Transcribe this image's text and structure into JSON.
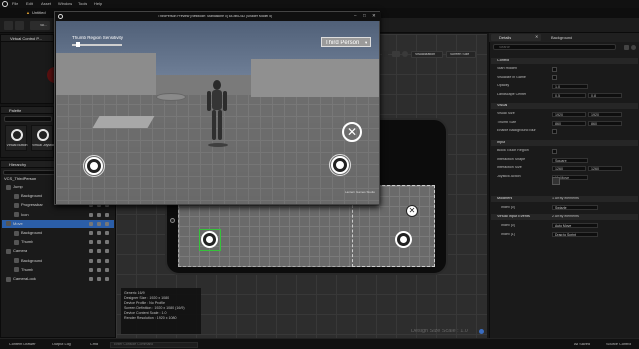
{
  "menu": {
    "items": [
      "File",
      "Edit",
      "Asset",
      "Window",
      "Tools",
      "Help"
    ],
    "project": "Untitled"
  },
  "doc_tab": "Sk...",
  "virtual_control_tab": "Virtual Control P...",
  "palette": {
    "title": "Palette",
    "items": [
      "Virtual Button",
      "Virtual Joystick"
    ]
  },
  "hierarchy": {
    "title": "Hierarchy",
    "root": "VCS_ThirdPerson",
    "rows": [
      {
        "label": "Jump",
        "indent": 1,
        "selected": false
      },
      {
        "label": "Background",
        "indent": 2,
        "selected": false
      },
      {
        "label": "Progressbar",
        "indent": 2,
        "selected": false
      },
      {
        "label": "Icon",
        "indent": 2,
        "selected": false
      },
      {
        "label": "Move",
        "indent": 1,
        "selected": true
      },
      {
        "label": "Background",
        "indent": 2,
        "selected": false
      },
      {
        "label": "Thumb",
        "indent": 2,
        "selected": false
      },
      {
        "label": "Camera",
        "indent": 1,
        "selected": false
      },
      {
        "label": "Background",
        "indent": 2,
        "selected": false
      },
      {
        "label": "Thumb",
        "indent": 2,
        "selected": false
      },
      {
        "label": "CameraLook",
        "indent": 1,
        "selected": false
      }
    ]
  },
  "pie": {
    "title": "ThirdPerson Preview [NetMode: Standalone 0] 64-bit/D3D (Shader Model 5)",
    "slider_label": "Thumb Region Sensitivity",
    "dropdown": "Third Person",
    "watermark": "Lantern Games Studio"
  },
  "designer": {
    "visualization": "Visualization",
    "screen_size": "Screen Size",
    "info_lines": [
      "Generic 16/9",
      "Designer Size : 1920 x 1080",
      "Device Profile : No Profile",
      "Screen Definition : 1920 x 1080 (16/9)",
      "Device Content Scale : 1.0",
      "Render Resolution : 1920 x 1080"
    ],
    "design_scale": "Design Size Scale : 1.0"
  },
  "details": {
    "tab": "Details",
    "tab2": "Background",
    "search_placeholder": "Search",
    "sections": {
      "control": "Control",
      "visual": "Visual",
      "input": "Input",
      "modifiers": "Modifiers",
      "virtual_input": "Virtual Input Events"
    },
    "control_rows": [
      {
        "label": "Start Hidden",
        "value": ""
      },
      {
        "label": "Visualize in Game",
        "value": ""
      },
      {
        "label": "Opacity",
        "value": "1.0"
      },
      {
        "label": "Landscape Center",
        "value": "0.5",
        "value2": "0.8"
      }
    ],
    "visual_rows": [
      {
        "label": "Visual Size",
        "value": "1920",
        "value2": "1920"
      },
      {
        "label": "Thumb Size",
        "value": "860",
        "value2": "860"
      },
      {
        "label": "Enable Background Blur",
        "value": ""
      }
    ],
    "input_rows": [
      {
        "label": "Block Touch Region",
        "value": ""
      },
      {
        "label": "Interaction Shape",
        "value": "Square"
      },
      {
        "label": "Interaction Size",
        "value": "1260",
        "value2": "1260"
      },
      {
        "label": "Joystick Action",
        "value": "IA_Move"
      }
    ],
    "modifiers_label": "Modifiers",
    "modifiers_count": "1 Array elements",
    "modifiers_index": "Index [0]",
    "modifiers_value": "Swizzle",
    "vi_label": "Virtual Input Events",
    "vi_count": "2 Array elements",
    "vi_rows": [
      {
        "label": "Index [0]",
        "value": "Auto Move"
      },
      {
        "label": "Index [1]",
        "value": "Drag to Sprint"
      }
    ]
  },
  "status": {
    "content_drawer": "Content Drawer",
    "output_log": "Output Log",
    "cmd": "Cmd",
    "console_placeholder": "Enter Console Command",
    "saved": "All Saved",
    "source_control": "Source Control"
  },
  "colors": {
    "accent": "#2b5ea8",
    "selection_green": "#35c23a"
  }
}
